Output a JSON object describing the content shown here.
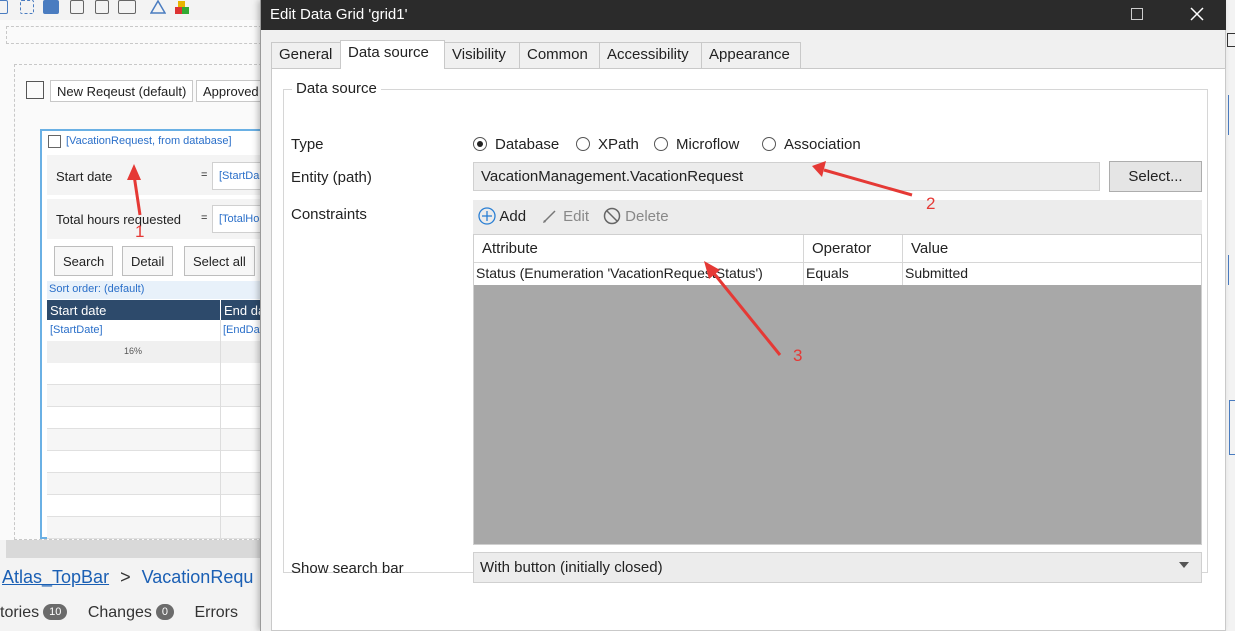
{
  "background": {
    "form_tabs": [
      "New Reqeust (default)",
      "Approved"
    ],
    "data_view_label": "[VacationRequest, from database]",
    "fields": [
      {
        "label": "Start date",
        "eq": "=",
        "value": "[StartDa"
      },
      {
        "label": "Total hours requested",
        "eq": "=",
        "value": "[TotalHo"
      }
    ],
    "buttons": [
      "Search",
      "Detail",
      "Select all"
    ],
    "sort_order": "Sort order: (default)",
    "grid_headers": [
      "Start date",
      "End da"
    ],
    "grid_row_values": [
      "[StartDate]",
      "[EndDat"
    ],
    "grid_width_label": "16%",
    "breadcrumb": {
      "first": "Atlas_TopBar",
      "sep": ">",
      "second": "VacationRequ"
    },
    "status": {
      "stories_label": "tories",
      "stories_count": "10",
      "changes_label": "Changes",
      "changes_count": "0",
      "errors_label": "Errors"
    }
  },
  "dialog": {
    "title": "Edit Data Grid 'grid1'",
    "maximize_icon": "maximize-icon",
    "close_icon": "close-icon",
    "tabs": [
      "General",
      "Data source",
      "Visibility",
      "Common",
      "Accessibility",
      "Appearance"
    ],
    "active_tab": "Data source",
    "group_title": "Data source",
    "type_label": "Type",
    "type_options": [
      "Database",
      "XPath",
      "Microflow",
      "Association"
    ],
    "type_selected": "Database",
    "entity_label": "Entity (path)",
    "entity_value": "VacationManagement.VacationRequest",
    "select_button": "Select...",
    "constraints_label": "Constraints",
    "toolbar": {
      "add": "Add",
      "edit": "Edit",
      "delete": "Delete"
    },
    "constraint_headers": [
      "Attribute",
      "Operator",
      "Value"
    ],
    "constraint_rows": [
      {
        "attribute": "Status (Enumeration 'VacationRequestStatus')",
        "operator": "Equals",
        "value": "Submitted"
      }
    ],
    "search_bar_label": "Show search bar",
    "search_bar_value": "With button (initially closed)"
  },
  "annotations": [
    "1",
    "2",
    "3"
  ],
  "colors": {
    "annotation": "#e53935",
    "titlebar": "#2b2b2b",
    "link": "#1a5fb4"
  }
}
